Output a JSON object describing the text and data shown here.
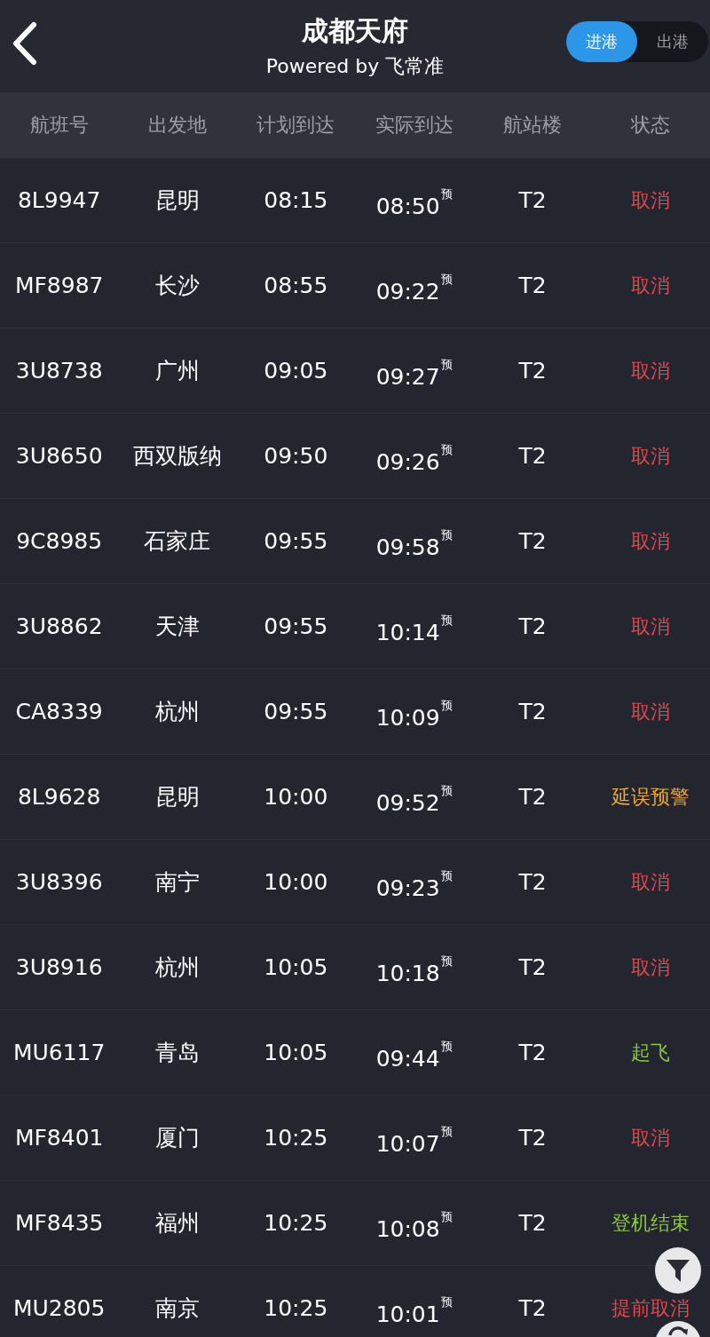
{
  "header": {
    "title": "成都天府",
    "subtitle": "Powered by 飞常准"
  },
  "tabs": [
    {
      "label": "进港",
      "selected": true
    },
    {
      "label": "出港",
      "selected": false
    }
  ],
  "table": {
    "columns": [
      "航班号",
      "出发地",
      "计划到达",
      "实际到达",
      "航站楼",
      "状态"
    ],
    "rows": [
      {
        "flight": "8L9947",
        "origin": "昆明",
        "scheduled": "08:15",
        "actual": "08:50$^{预}$",
        "terminal": "T2",
        "status": "取消",
        "color": "#e0484b"
      },
      {
        "flight": "MF8987",
        "origin": "长沙",
        "scheduled": "08:55",
        "actual": "09:22$^{预}$",
        "terminal": "T2",
        "status": "取消",
        "color": "#e0484b"
      },
      {
        "flight": "3U8738",
        "origin": "广州",
        "scheduled": "09:05",
        "actual": "09:27$^{预}$",
        "terminal": "T2",
        "status": "取消",
        "color": "#e0484b"
      },
      {
        "flight": "3U8650",
        "origin": "西双版纳",
        "scheduled": "09:50",
        "actual": "09:26$^{预}$",
        "terminal": "T2",
        "status": "取消",
        "color": "#e0484b"
      },
      {
        "flight": "9C8985",
        "origin": "石家庄",
        "scheduled": "09:55",
        "actual": "09:58$^{预}$",
        "terminal": "T2",
        "status": "取消",
        "color": "#e0484b"
      },
      {
        "flight": "3U8862",
        "origin": "天津",
        "scheduled": "09:55",
        "actual": "10:14$^{预}$",
        "terminal": "T2",
        "status": "取消",
        "color": "#e0484b"
      },
      {
        "flight": "CA8339",
        "origin": "杭州",
        "scheduled": "09:55",
        "actual": "10:09$^{预}$",
        "terminal": "T2",
        "status": "取消",
        "color": "#e0484b"
      },
      {
        "flight": "8L9628",
        "origin": "昆明",
        "scheduled": "10:00",
        "actual": "09:52$^{预}$",
        "terminal": "T2",
        "status": "延误预警",
        "color": "#f0a830"
      },
      {
        "flight": "3U8396",
        "origin": "南宁",
        "scheduled": "10:00",
        "actual": "09:23$^{预}$",
        "terminal": "T2",
        "status": "取消",
        "color": "#e0484b"
      },
      {
        "flight": "3U8916",
        "origin": "杭州",
        "scheduled": "10:05",
        "actual": "10:18$^{预}$",
        "terminal": "T2",
        "status": "取消",
        "color": "#e0484b"
      },
      {
        "flight": "MU6117",
        "origin": "青岛",
        "scheduled": "10:05",
        "actual": "09:44$^{预}$",
        "terminal": "T2",
        "status": "起飞",
        "color": "#8cc63f"
      },
      {
        "flight": "MF8401",
        "origin": "厦门",
        "scheduled": "10:25",
        "actual": "10:07$^{预}$",
        "terminal": "T2",
        "status": "取消",
        "color": "#e0484b"
      },
      {
        "flight": "MF8435",
        "origin": "福州",
        "scheduled": "10:25",
        "actual": "10:08$^{预}$",
        "terminal": "T2",
        "status": "登机结束",
        "color": "#8cc63f"
      },
      {
        "flight": "MU2805",
        "origin": "南京",
        "scheduled": "10:25",
        "actual": "10:01$^{预}$",
        "terminal": "T2",
        "status": "提前取消",
        "color": "#e0484b"
      }
    ]
  }
}
